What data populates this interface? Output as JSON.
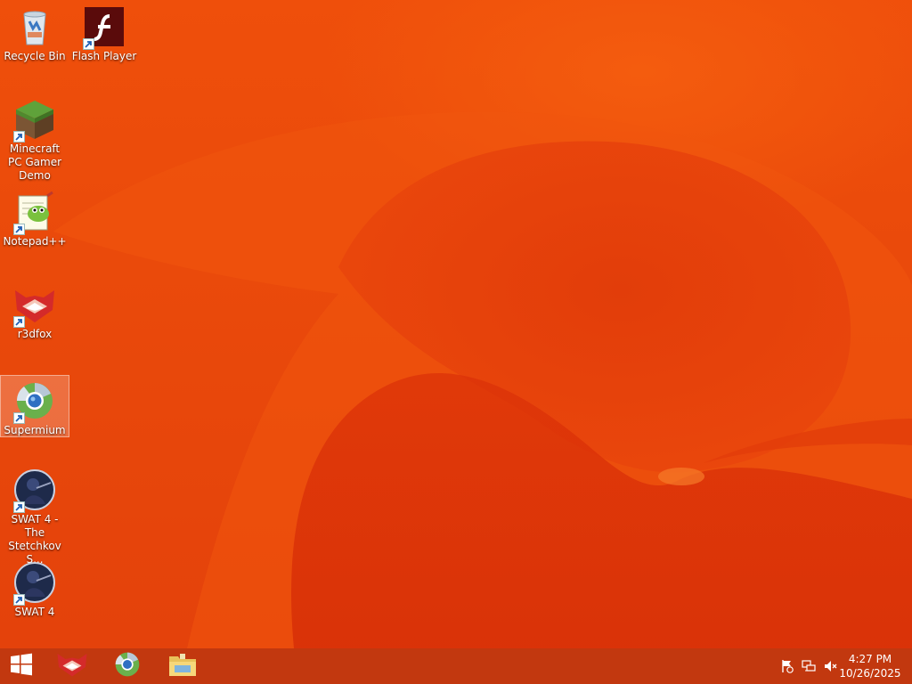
{
  "desktop": {
    "icons": [
      {
        "label": "Recycle Bin",
        "name": "recycle-bin"
      },
      {
        "label": "Flash Player",
        "name": "flash-player"
      },
      {
        "label": "Minecraft PC Gamer Demo",
        "name": "minecraft"
      },
      {
        "label": "Notepad++",
        "name": "notepad-plus-plus"
      },
      {
        "label": "r3dfox",
        "name": "r3dfox"
      },
      {
        "label": "Supermium",
        "name": "supermium",
        "selected": true
      },
      {
        "label": "SWAT 4 - The Stetchkov S...",
        "name": "swat4-stetchkov"
      },
      {
        "label": "SWAT 4",
        "name": "swat4"
      }
    ]
  },
  "taskbar": {
    "pinned": [
      "windows-start-icon",
      "r3dfox-icon",
      "supermium-icon",
      "file-explorer-icon"
    ],
    "tray": {
      "icons": [
        "action-center-flag-icon",
        "network-icon",
        "volume-muted-icon"
      ],
      "time": "4:27 PM",
      "date": "10/26/2025"
    }
  },
  "colors": {
    "wallpaper": "#e8450c",
    "taskbar": "#c2380f",
    "selection": "rgba(255,255,255,0.22)"
  }
}
